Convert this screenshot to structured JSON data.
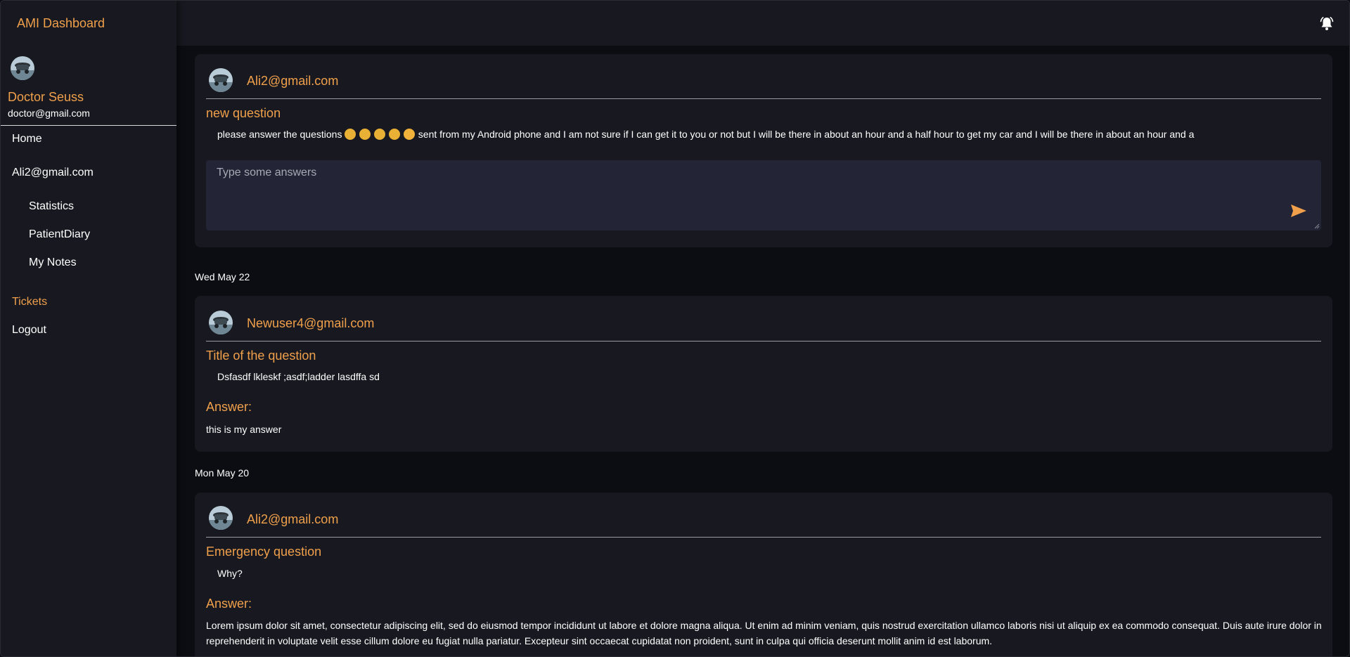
{
  "app": {
    "brand": "AMI Dashboard"
  },
  "sidebar": {
    "doctor_name": "Doctor Seuss",
    "doctor_email": "doctor@gmail.com",
    "items": [
      {
        "label": "Home"
      },
      {
        "label": "Ali2@gmail.com"
      },
      {
        "label": "Statistics"
      },
      {
        "label": "PatientDiary"
      },
      {
        "label": "My Notes"
      },
      {
        "label": "Tickets"
      },
      {
        "label": "Logout"
      }
    ]
  },
  "icons": {
    "bell": "bell-icon",
    "send": "send-icon",
    "avatar": "avatar"
  },
  "colors": {
    "accent": "#f0a04b",
    "background": "#0c0d12",
    "panel": "#181920",
    "input": "#232436"
  },
  "tickets": [
    {
      "user": "Ali2@gmail.com",
      "title": "new question",
      "body_prefix": "please answer the questions",
      "emoji_count": 5,
      "body_suffix": " sent from my Android phone and I am not sure if I can get it to you or not but I will be there in about an hour and a half hour to get my car and I will be there in about an hour and a",
      "answer_placeholder": "Type some answers"
    },
    {
      "date": "Wed May 22",
      "user": "Newuser4@gmail.com",
      "title": "Title of the question",
      "body": "Dsfasdf lkleskf ;asdf;ladder lasdffa sd",
      "answer_label": "Answer:",
      "answer": "this is my answer"
    },
    {
      "date": "Mon May 20",
      "user": "Ali2@gmail.com",
      "title": "Emergency question",
      "body": "Why?",
      "answer_label": "Answer:",
      "answer": "Lorem ipsum dolor sit amet, consectetur adipiscing elit, sed do eiusmod tempor incididunt ut labore et dolore magna aliqua. Ut enim ad minim veniam, quis nostrud exercitation ullamco laboris nisi ut aliquip ex ea commodo consequat. Duis aute irure dolor in reprehenderit in voluptate velit esse cillum dolore eu fugiat nulla pariatur. Excepteur sint occaecat cupidatat non proident, sunt in culpa qui officia deserunt mollit anim id est laborum."
    }
  ]
}
